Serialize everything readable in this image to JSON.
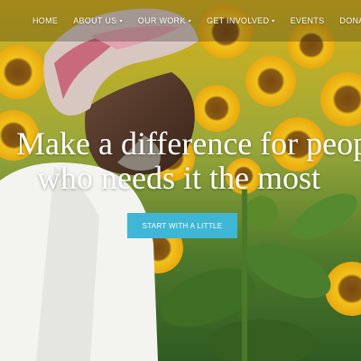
{
  "nav": {
    "items": [
      {
        "label": "HOME",
        "dropdown": false
      },
      {
        "label": "ABOUT US",
        "dropdown": true
      },
      {
        "label": "OUR WORK",
        "dropdown": true
      },
      {
        "label": "GET INVOLVED",
        "dropdown": true
      },
      {
        "label": "EVENTS",
        "dropdown": false
      },
      {
        "label": "DONATE",
        "dropdown": false
      }
    ]
  },
  "hero": {
    "headline_line1": "Make a difference for people",
    "headline_line2": "who needs it the most",
    "cta_label": "START WITH A LITTLE"
  },
  "colors": {
    "cta_background": "#3fb6d6",
    "headline_text": "#ffffff"
  },
  "icons": {
    "dropdown": "chevron-down-icon"
  }
}
